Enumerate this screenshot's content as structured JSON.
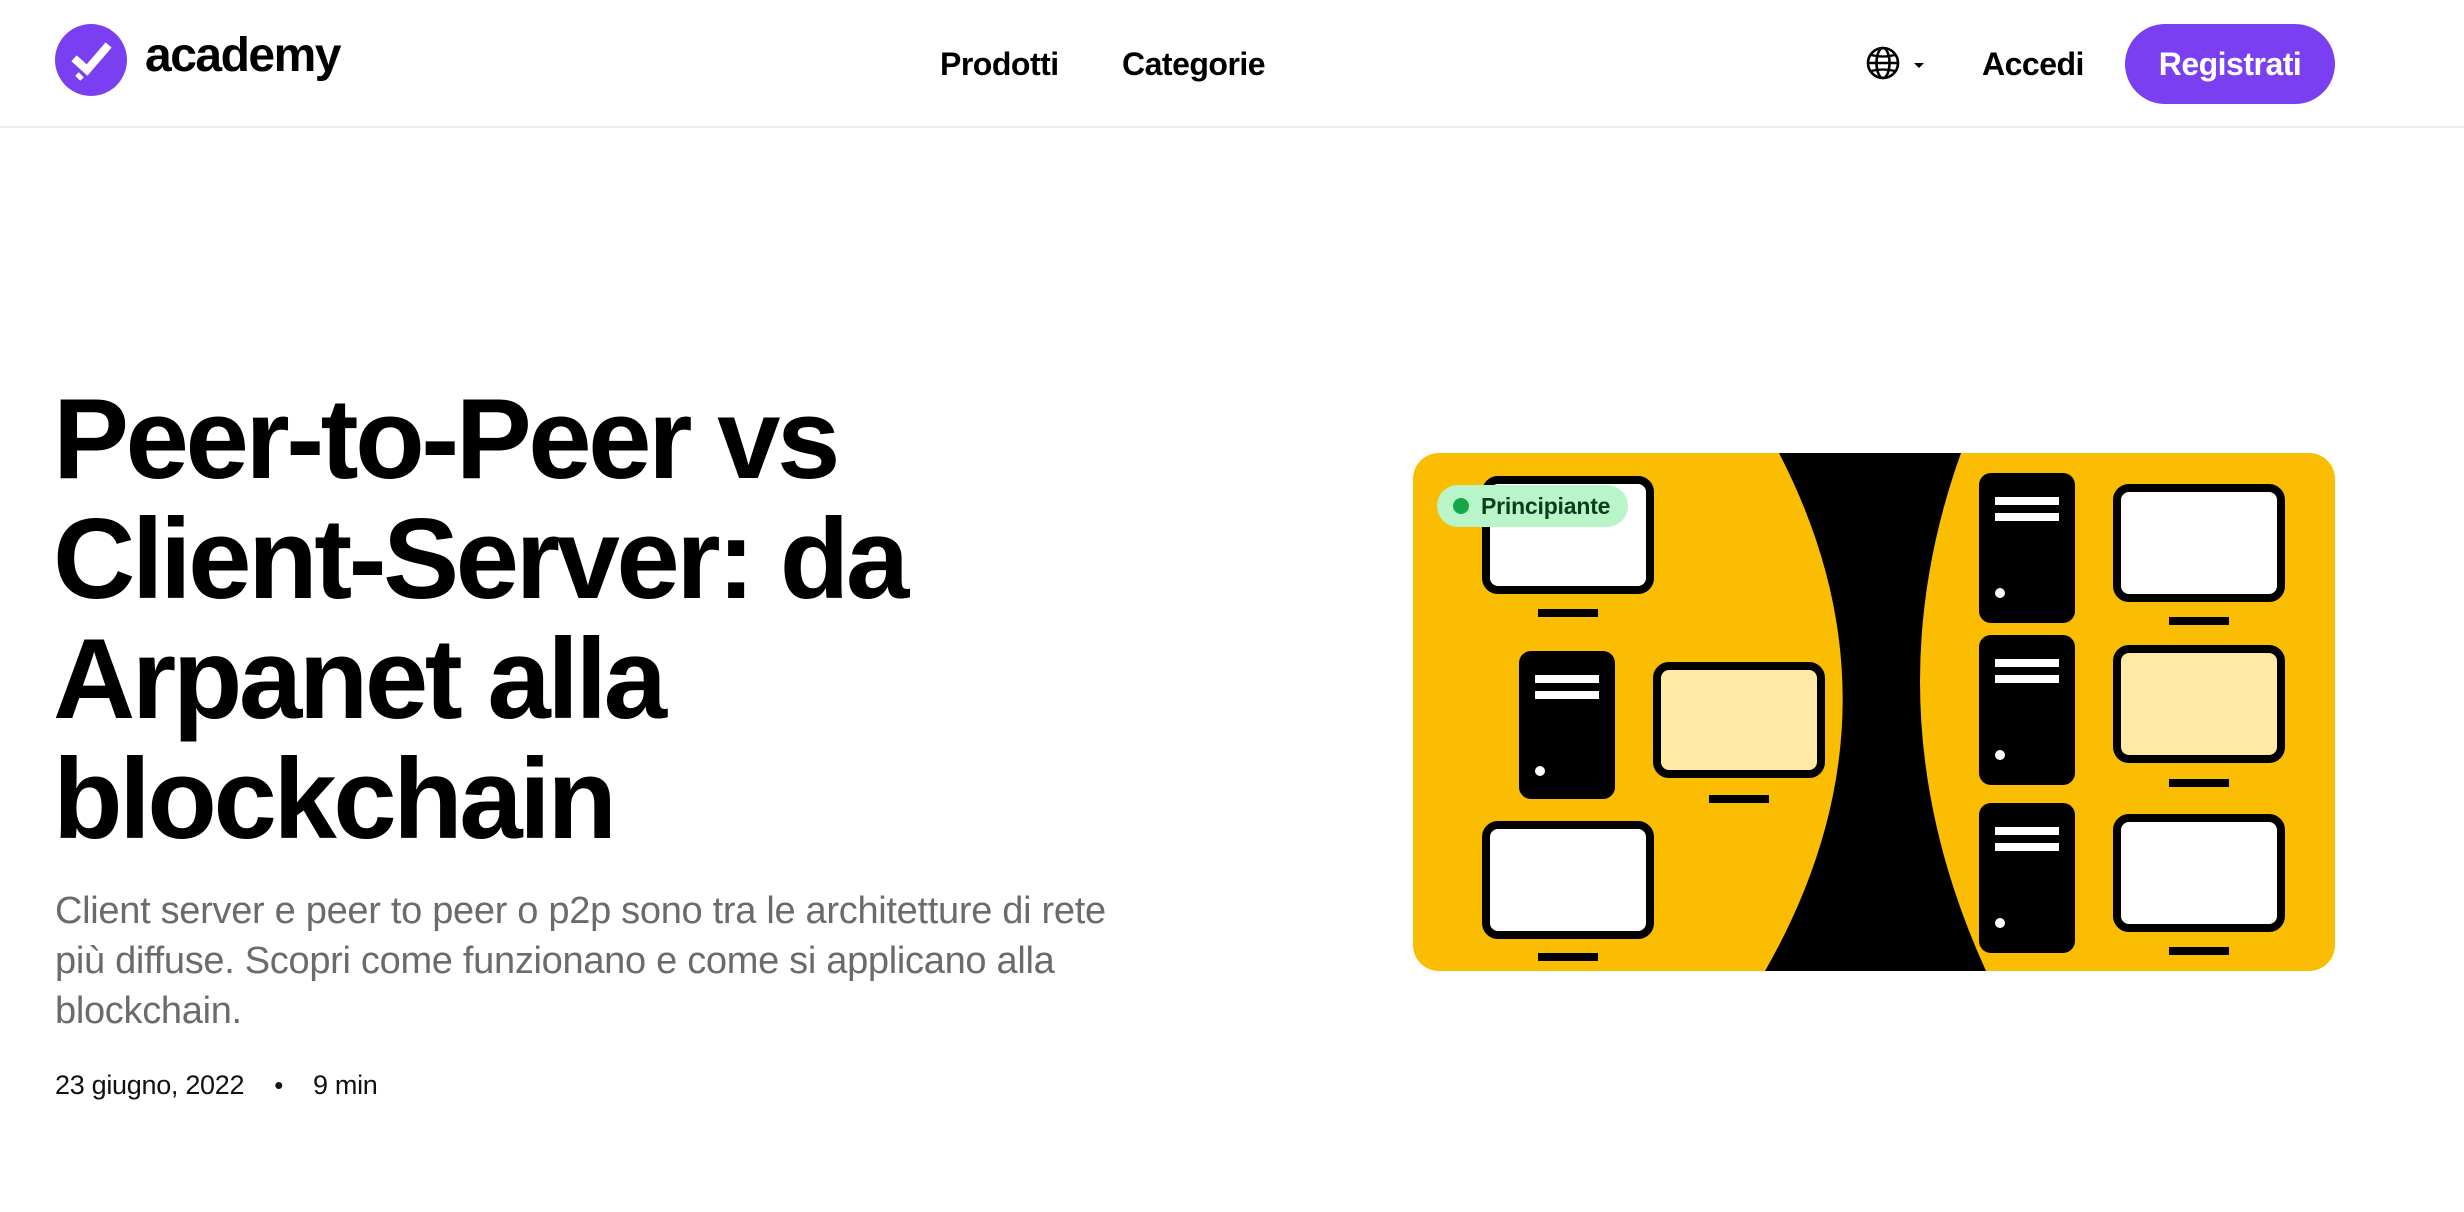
{
  "header": {
    "logo_text": "academy",
    "nav": [
      {
        "label": "Prodotti"
      },
      {
        "label": "Categorie"
      }
    ],
    "language_icon": "globe-icon",
    "login_label": "Accedi",
    "signup_label": "Registrati"
  },
  "article": {
    "title": "Peer-to-Peer vs Client-Server: da Arpanet alla blockchain",
    "subtitle": "Client server e peer to peer o p2p sono tra le architetture di rete più diffuse. Scopri come funzionano e come si applicano alla blockchain.",
    "date": "23 giugno, 2022",
    "separator": "•",
    "read_time": "9 min",
    "level_badge": "Principiante"
  },
  "colors": {
    "brand": "#7b3ff2",
    "illustration_bg": "#fbbd02",
    "badge_bg": "#b8f5c8",
    "badge_dot": "#17a74a",
    "subtitle_text": "#6b6b6b"
  }
}
